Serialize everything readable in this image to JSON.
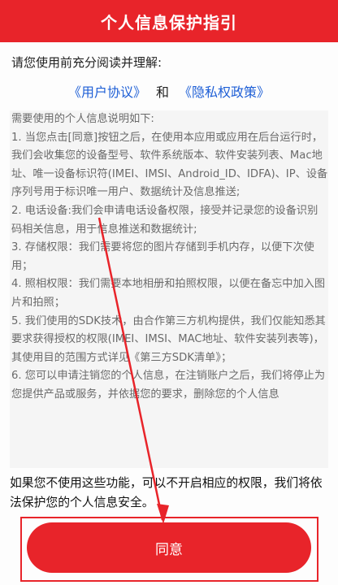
{
  "header": {
    "title": "个人信息保护指引"
  },
  "intro": {
    "text": "请您使用前充分阅读并理解:"
  },
  "links": {
    "user_agreement": "《用户协议》",
    "and": "和",
    "privacy_policy": "《隐私权政策》"
  },
  "content": {
    "heading": "需要使用的个人信息说明如下:",
    "items": [
      "1. 当您点击[同意]按钮之后，在使用本应用或应用在后台运行时，我们会收集您的设备型号、软件系统版本、软件安装列表、Mac地址、唯一设备标识符(IMEI、IMSI、Android_ID、IDFA)、IP、设备序列号用于标识唯一用户、数据统计及信息推送;",
      "2. 电话设备:我们会申请电话设备权限，接受并记录您的设备识别码相关信息，用于信息推送和数据统计;",
      "3. 存储权限：我们需要将您的图片存储到手机内存，以便下次使用；",
      "4. 照相权限：我们需要本地相册和拍照权限，以便在备忘中加入图片和拍照；",
      "5. 我们使用的SDK技术，由合作第三方机构提供，我们仅能知悉其要求获得授权的权限(IMEI、IMSI、MAC地址、软件安装列表等)，其使用目的范围方式详见《第三方SDK清单》；",
      "6. 您可以申请注销您的个人信息，在注销账户之后，我们将停止为您提供产品或服务，并依据您的要求，删除您的个人信息"
    ]
  },
  "footer": {
    "text": "如果您不使用这些功能，可以不开启相应的权限，我们将依法保护您的个人信息安全。"
  },
  "agree_button": {
    "label": "同意"
  },
  "colors": {
    "accent": "#e8242a",
    "link": "#1e5fd6"
  }
}
